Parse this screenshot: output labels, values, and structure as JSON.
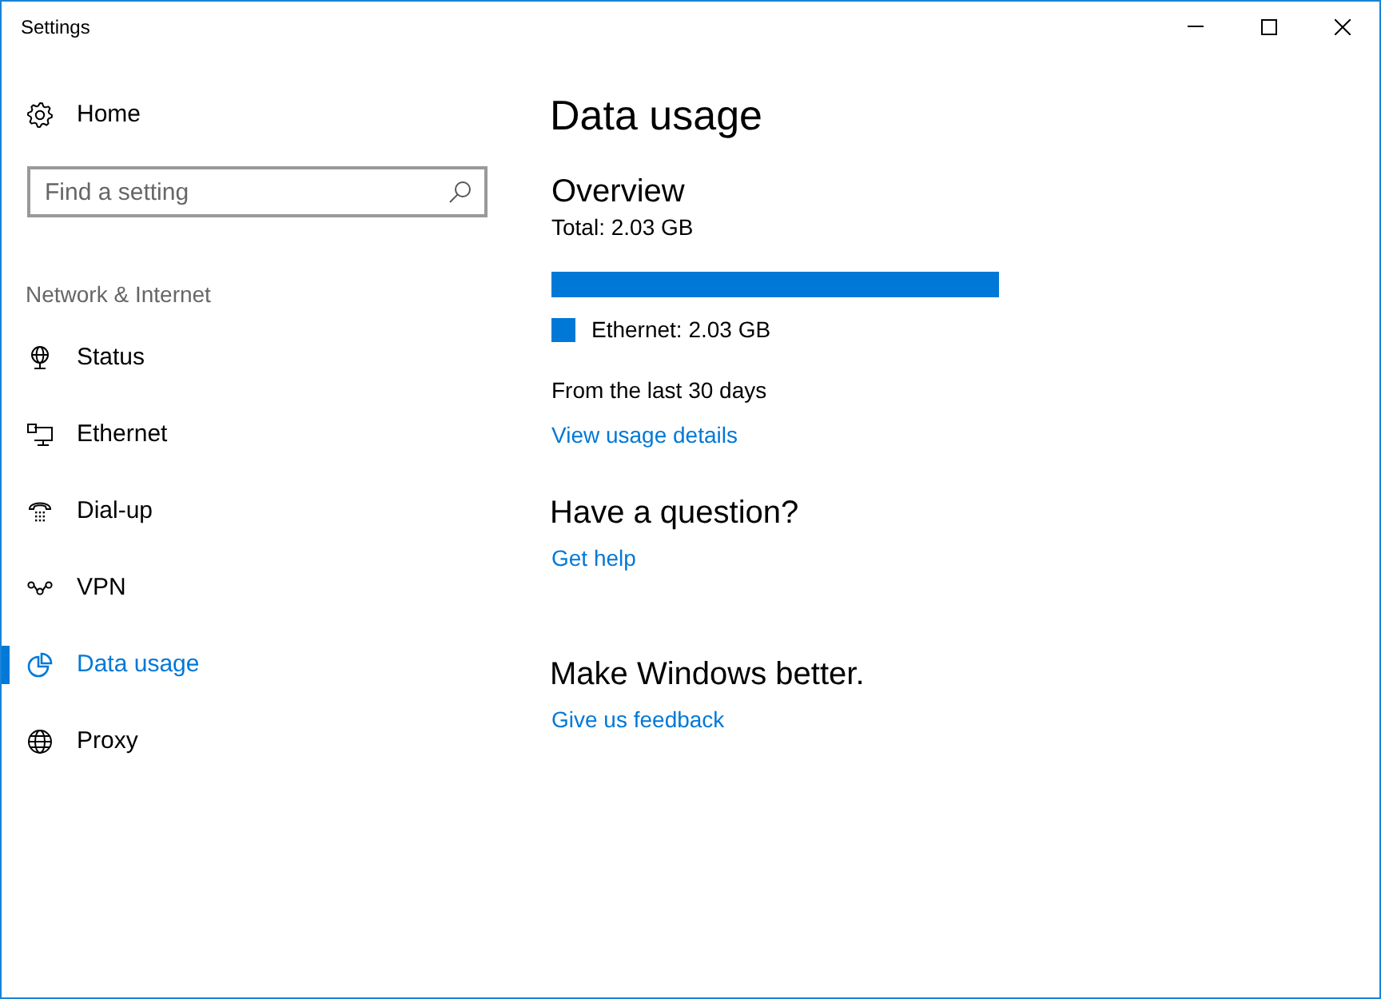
{
  "window": {
    "title": "Settings"
  },
  "sidebar": {
    "home": {
      "label": "Home"
    },
    "search": {
      "placeholder": "Find a setting"
    },
    "section": "Network & Internet",
    "items": [
      {
        "label": "Status",
        "selected": false
      },
      {
        "label": "Ethernet",
        "selected": false
      },
      {
        "label": "Dial-up",
        "selected": false
      },
      {
        "label": "VPN",
        "selected": false
      },
      {
        "label": "Data usage",
        "selected": true
      },
      {
        "label": "Proxy",
        "selected": false
      }
    ]
  },
  "content": {
    "title": "Data usage",
    "overview": {
      "heading": "Overview",
      "total": "Total: 2.03 GB",
      "usage_bar": {
        "level": 1
      },
      "legend": [
        {
          "label": "Ethernet: 2.03 GB",
          "color": "#0078d7"
        }
      ],
      "period": "From the last 30 days",
      "link": "View usage details"
    },
    "sections": [
      {
        "heading": "Have a question?",
        "link": "Get help"
      },
      {
        "heading": "Make Windows better.",
        "link": "Give us feedback"
      }
    ]
  }
}
